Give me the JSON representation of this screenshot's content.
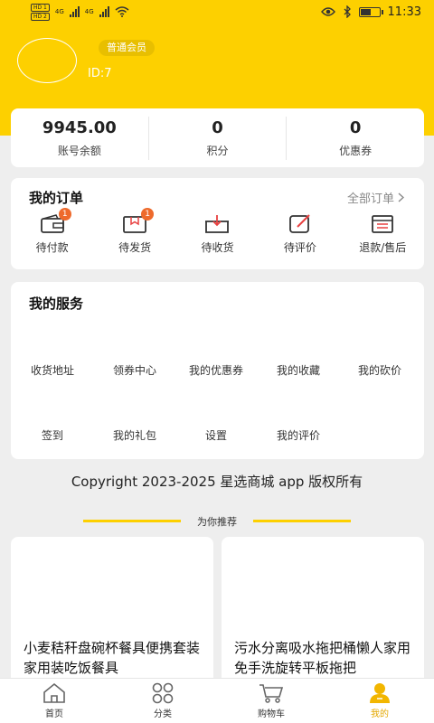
{
  "status_bar": {
    "hd1": "HD 1",
    "hd2": "HD 2",
    "net1": "4G",
    "net2": "4G",
    "time": "11:33"
  },
  "profile": {
    "member_level": "普通会员",
    "user_id": "ID:7"
  },
  "stats": [
    {
      "value": "9945.00",
      "label": "账号余额"
    },
    {
      "value": "0",
      "label": "积分"
    },
    {
      "value": "0",
      "label": "优惠券"
    }
  ],
  "orders": {
    "title": "我的订单",
    "all_label": "全部订单",
    "items": [
      {
        "label": "待付款",
        "badge": "1",
        "icon": "wallet-icon"
      },
      {
        "label": "待发货",
        "badge": "1",
        "icon": "package-icon"
      },
      {
        "label": "待收货",
        "badge": "",
        "icon": "inbox-icon"
      },
      {
        "label": "待评价",
        "badge": "",
        "icon": "edit-icon"
      },
      {
        "label": "退款/售后",
        "badge": "",
        "icon": "list-icon"
      }
    ]
  },
  "services": {
    "title": "我的服务",
    "items": [
      "收货地址",
      "领券中心",
      "我的优惠券",
      "我的收藏",
      "我的砍价",
      "签到",
      "我的礼包",
      "设置",
      "我的评价"
    ]
  },
  "copyright": "Copyright 2023-2025 星选商城 app 版权所有",
  "recommend": {
    "title": "为你推荐",
    "products": [
      {
        "name": "小麦秸秆盘碗杯餐具便携套装家用装吃饭餐具"
      },
      {
        "name": "污水分离吸水拖把桶懒人家用免手洗旋转平板拖把"
      }
    ]
  },
  "tabbar": [
    {
      "label": "首页",
      "icon": "home-icon"
    },
    {
      "label": "分类",
      "icon": "category-icon"
    },
    {
      "label": "购物车",
      "icon": "cart-icon"
    },
    {
      "label": "我的",
      "icon": "user-icon",
      "active": true
    }
  ],
  "colors": {
    "brand": "#fdd000",
    "badge": "#ee6a2c",
    "active_tab": "#e4a800"
  }
}
